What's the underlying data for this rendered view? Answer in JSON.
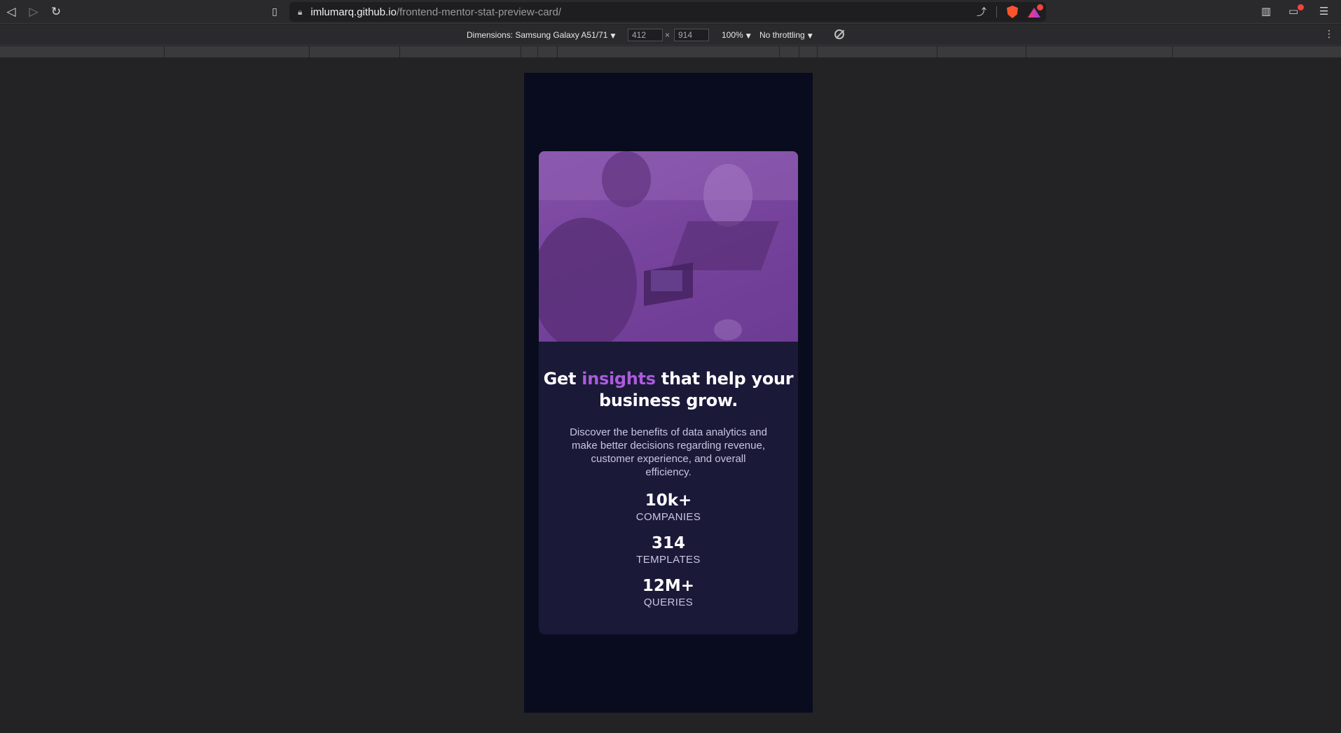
{
  "browser": {
    "url_host": "imlumarq.github.io",
    "url_path": "/frontend-mentor-stat-preview-card/",
    "back_icon": "back-arrow-icon",
    "forward_icon": "forward-arrow-icon",
    "reload_icon": "reload-icon"
  },
  "devtools": {
    "dimensions_label": "Dimensions: Samsung Galaxy A51/71",
    "width": "412",
    "times": "×",
    "height": "914",
    "zoom": "100%",
    "throttling": "No throttling",
    "dropdown_arrow": "▼"
  },
  "card": {
    "headline_before": "Get ",
    "headline_accent": "insights",
    "headline_after": " that help your business grow.",
    "description": "Discover the benefits of data analytics and make better decisions regarding revenue, customer experience, and overall efficiency.",
    "stats": [
      {
        "value": "10k+",
        "label": "COMPANIES"
      },
      {
        "value": "314",
        "label": "TEMPLATES"
      },
      {
        "value": "12M+",
        "label": "QUERIES"
      }
    ]
  },
  "colors": {
    "page_bg": "#090c1e",
    "card_bg": "#1b1938",
    "accent": "#aa5cdb",
    "text_main": "#ffffff",
    "text_muted": "#c8c5e0"
  }
}
